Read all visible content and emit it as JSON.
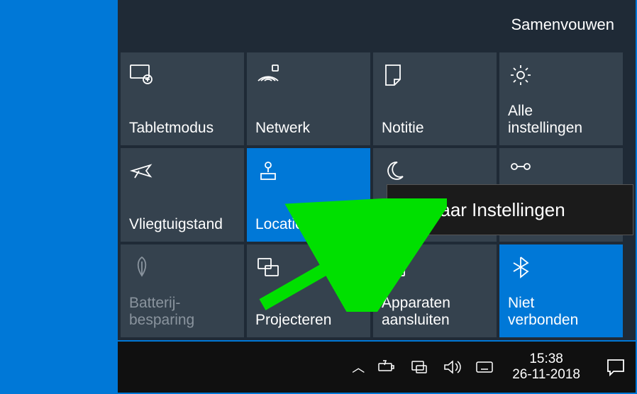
{
  "collapse_label": "Samenvouwen",
  "tiles": [
    {
      "label": "Tabletmodus"
    },
    {
      "label": "Netwerk"
    },
    {
      "label": "Notitie"
    },
    {
      "label": "Alle\ninstellingen"
    },
    {
      "label": "Vliegtuigstand"
    },
    {
      "label": "Locatie"
    },
    {
      "label": "Stille uren"
    },
    {
      "label": "VPN"
    },
    {
      "label": "Batterij-\nbesparing"
    },
    {
      "label": "Projecteren"
    },
    {
      "label": "Apparaten\naansluiten"
    },
    {
      "label": "Niet\nverbonden"
    }
  ],
  "tooltip": "Ga naar Instellingen",
  "clock": {
    "time": "15:38",
    "date": "26-11-2018"
  }
}
